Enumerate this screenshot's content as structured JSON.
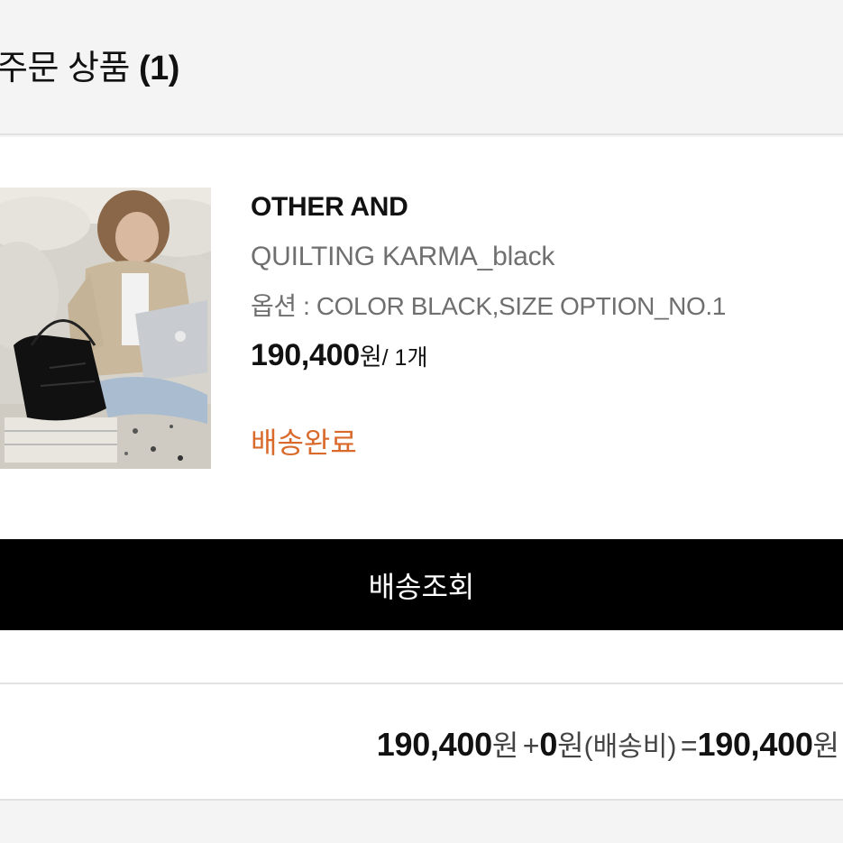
{
  "header": {
    "title": "주문 상품",
    "count": "(1)"
  },
  "product": {
    "image_icon": "product-photo",
    "brand": "OTHER AND",
    "name": "QUILTING KARMA_black",
    "option": "옵션 : COLOR BLACK,SIZE OPTION_NO.1",
    "price": "190,400",
    "price_unit": "원",
    "quantity": "/ 1개",
    "status": "배송완료",
    "status_color": "#d96a2b"
  },
  "actions": {
    "track_label": "배송조회"
  },
  "total": {
    "subtotal": "190,400",
    "subtotal_unit": "원",
    "plus": "+",
    "shipping": "0",
    "shipping_unit": "원",
    "shipping_label": "(배송비)",
    "equals": "=",
    "grand_total": "190,400",
    "grand_total_unit": "원"
  }
}
